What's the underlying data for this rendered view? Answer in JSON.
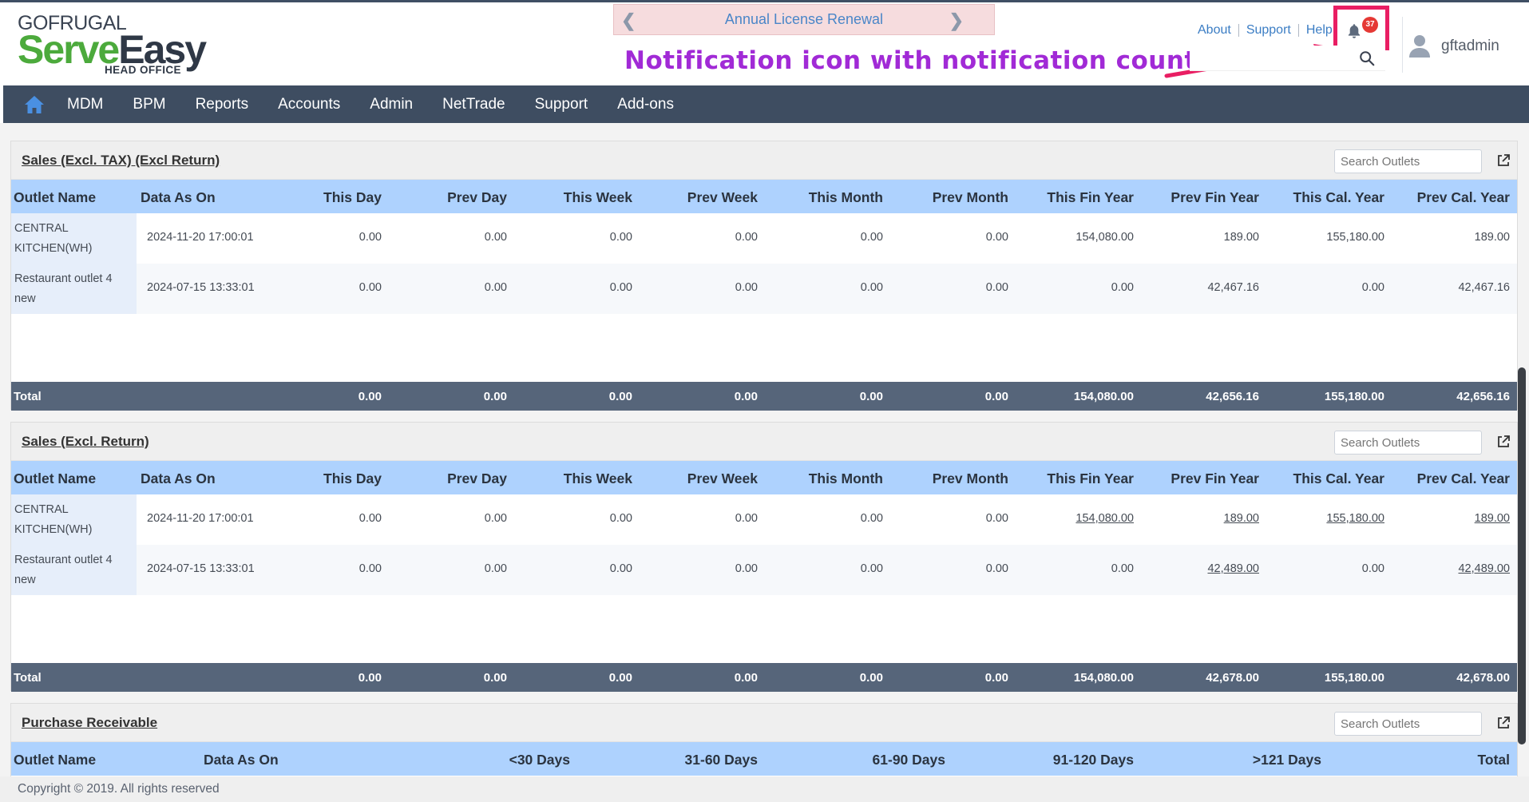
{
  "logo": {
    "gofrugal": "GOFRUGAL",
    "serve": "Serve",
    "easy": "Easy",
    "sub": "HEAD OFFICE"
  },
  "license_banner": {
    "text": "Annual License Renewal"
  },
  "annotation": {
    "text": "Notification icon with notification count",
    "color": "#a12ad6",
    "arrow_color": "#e91e63"
  },
  "top_links": {
    "about": "About",
    "support": "Support",
    "help": "Help"
  },
  "notifications": {
    "count": "37",
    "icon": "bell-icon"
  },
  "user": {
    "name": "gftadmin",
    "icon": "user-avatar-icon"
  },
  "nav": {
    "home_icon": "home-icon",
    "items": [
      "MDM",
      "BPM",
      "Reports",
      "Accounts",
      "Admin",
      "NetTrade",
      "Support",
      "Add-ons"
    ]
  },
  "columns": [
    "Outlet Name",
    "Data As On",
    "This Day",
    "Prev Day",
    "This Week",
    "Prev Week",
    "This Month",
    "Prev Month",
    "This Fin Year",
    "Prev Fin Year",
    "This Cal. Year",
    "Prev Cal. Year"
  ],
  "panels": [
    {
      "title": "Sales (Excl. TAX) (Excl Return)",
      "search_placeholder": "Search Outlets",
      "rows": [
        {
          "outlet": "CENTRAL KITCHEN(WH)",
          "as_on": "2024-11-20 17:00:01",
          "values": [
            "0.00",
            "0.00",
            "0.00",
            "0.00",
            "0.00",
            "0.00",
            "154,080.00",
            "189.00",
            "155,180.00",
            "189.00"
          ]
        },
        {
          "outlet": "Restaurant outlet 4 new",
          "as_on": "2024-07-15 13:33:01",
          "values": [
            "0.00",
            "0.00",
            "0.00",
            "0.00",
            "0.00",
            "0.00",
            "0.00",
            "42,467.16",
            "0.00",
            "42,467.16"
          ]
        }
      ],
      "total": {
        "label": "Total",
        "values": [
          "0.00",
          "0.00",
          "0.00",
          "0.00",
          "0.00",
          "0.00",
          "154,080.00",
          "42,656.16",
          "155,180.00",
          "42,656.16"
        ]
      }
    },
    {
      "title": "Sales (Excl. Return)",
      "search_placeholder": "Search Outlets",
      "rows": [
        {
          "outlet": "CENTRAL KITCHEN(WH)",
          "as_on": "2024-11-20 17:00:01",
          "values": [
            "0.00",
            "0.00",
            "0.00",
            "0.00",
            "0.00",
            "0.00",
            "154,080.00",
            "189.00",
            "155,180.00",
            "189.00"
          ]
        },
        {
          "outlet": "Restaurant outlet 4 new",
          "as_on": "2024-07-15 13:33:01",
          "values": [
            "0.00",
            "0.00",
            "0.00",
            "0.00",
            "0.00",
            "0.00",
            "0.00",
            "42,489.00",
            "0.00",
            "42,489.00"
          ]
        }
      ],
      "total": {
        "label": "Total",
        "values": [
          "0.00",
          "0.00",
          "0.00",
          "0.00",
          "0.00",
          "0.00",
          "154,080.00",
          "42,678.00",
          "155,180.00",
          "42,678.00"
        ]
      }
    }
  ],
  "purchase_panel": {
    "title": "Purchase Receivable",
    "search_placeholder": "Search Outlets",
    "columns": [
      "Outlet Name",
      "Data As On",
      "<30 Days",
      "31-60 Days",
      "61-90 Days",
      "91-120 Days",
      ">121 Days",
      "Total"
    ]
  },
  "footer": {
    "text": "Copyright © 2019. All rights reserved"
  }
}
